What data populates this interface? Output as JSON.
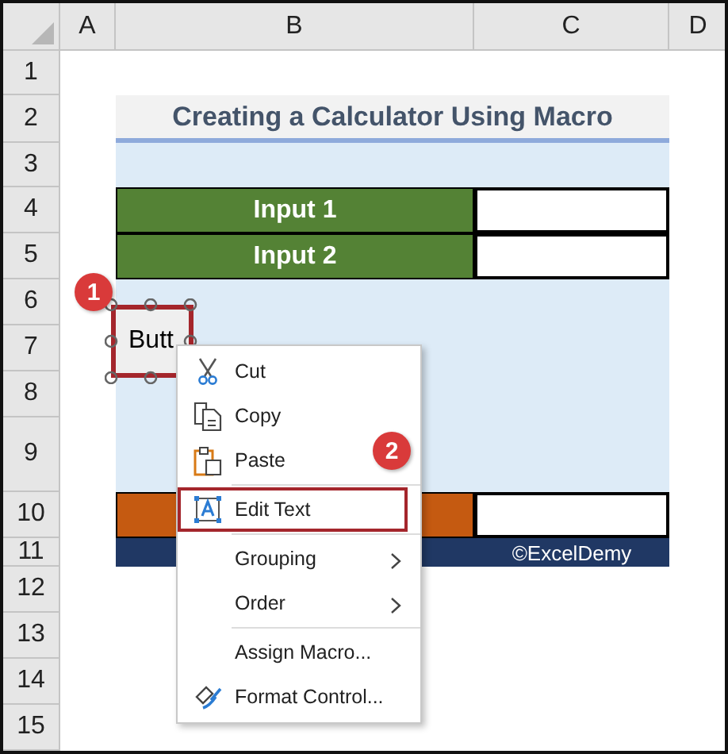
{
  "columns": [
    "A",
    "B",
    "C",
    "D"
  ],
  "rows": [
    {
      "header": "1",
      "kind": "blank"
    },
    {
      "header": "2",
      "kind": "title",
      "text": "Creating a Calculator Using Macro"
    },
    {
      "header": "3",
      "kind": "fill"
    },
    {
      "header": "4",
      "kind": "input",
      "text": "Input 1"
    },
    {
      "header": "5",
      "kind": "input",
      "text": "Input 2"
    },
    {
      "header": "6",
      "kind": "fill"
    },
    {
      "header": "7",
      "kind": "fill"
    },
    {
      "header": "8",
      "kind": "fill"
    },
    {
      "header": "9",
      "kind": "fill"
    },
    {
      "header": "10",
      "kind": "result"
    },
    {
      "header": "11",
      "kind": "footer",
      "text": "©ExcelDemy"
    },
    {
      "header": "12",
      "kind": "blank"
    },
    {
      "header": "13",
      "kind": "blank"
    },
    {
      "header": "14",
      "kind": "blank"
    },
    {
      "header": "15",
      "kind": "blank"
    }
  ],
  "form_button": {
    "label": "Butt",
    "selected": true
  },
  "context_menu": [
    {
      "kind": "item",
      "label": "Cut",
      "highlighted": false
    },
    {
      "kind": "item",
      "label": "Copy",
      "highlighted": false
    },
    {
      "kind": "item",
      "label": "Paste",
      "highlighted": false
    },
    {
      "kind": "separator"
    },
    {
      "kind": "item",
      "label": "Edit Text",
      "highlighted": true
    },
    {
      "kind": "separator"
    },
    {
      "kind": "submenu",
      "label": "Grouping",
      "highlighted": false
    },
    {
      "kind": "submenu",
      "label": "Order",
      "highlighted": false
    },
    {
      "kind": "separator"
    },
    {
      "kind": "item",
      "label": "Assign Macro...",
      "highlighted": false
    },
    {
      "kind": "item",
      "label": "Format Control...",
      "highlighted": false
    }
  ],
  "step_badges": [
    {
      "label": "1"
    },
    {
      "label": "2"
    }
  ]
}
